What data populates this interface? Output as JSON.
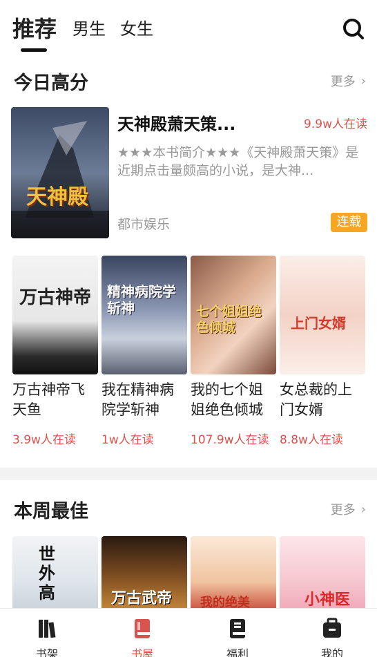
{
  "tabs": [
    {
      "label": "推荐"
    },
    {
      "label": "男生"
    },
    {
      "label": "女生"
    }
  ],
  "today": {
    "title": "今日高分",
    "more": "更多",
    "featured": {
      "title": "天神殿萧天策...",
      "readers": "9.9w人在读",
      "description": "★★★本书简介★★★《天神殿萧天策》是近期点击量颇高的小说，是大神...",
      "genre": "都市娱乐",
      "status": "连载",
      "cover_text": "天神殿"
    },
    "books": [
      {
        "title": "万古神帝飞天鱼",
        "readers": "3.9w人在读",
        "cover_text": "万古神帝"
      },
      {
        "title": "我在精神病院学斩神",
        "readers": "1w人在读",
        "cover_text": "精神病院学斩神"
      },
      {
        "title": "我的七个姐姐绝色倾城",
        "readers": "107.9w人在读",
        "cover_text": "七个姐姐绝色倾城"
      },
      {
        "title": "女总裁的上门女婿",
        "readers": "8.8w人在读",
        "cover_text": "上门女婿"
      }
    ]
  },
  "week": {
    "title": "本周最佳",
    "more": "更多",
    "covers": [
      {
        "cover_text": "世外高"
      },
      {
        "cover_text": "万古武帝"
      },
      {
        "cover_text": "我的绝美"
      },
      {
        "cover_text": "小神医"
      }
    ]
  },
  "nav": [
    {
      "label": "书架",
      "icon": "bookshelf-icon"
    },
    {
      "label": "书屋",
      "icon": "bookstore-icon"
    },
    {
      "label": "福利",
      "icon": "welfare-icon"
    },
    {
      "label": "我的",
      "icon": "profile-icon"
    }
  ],
  "colors": {
    "accent": "#d9534f",
    "badge": "#f6a623"
  }
}
